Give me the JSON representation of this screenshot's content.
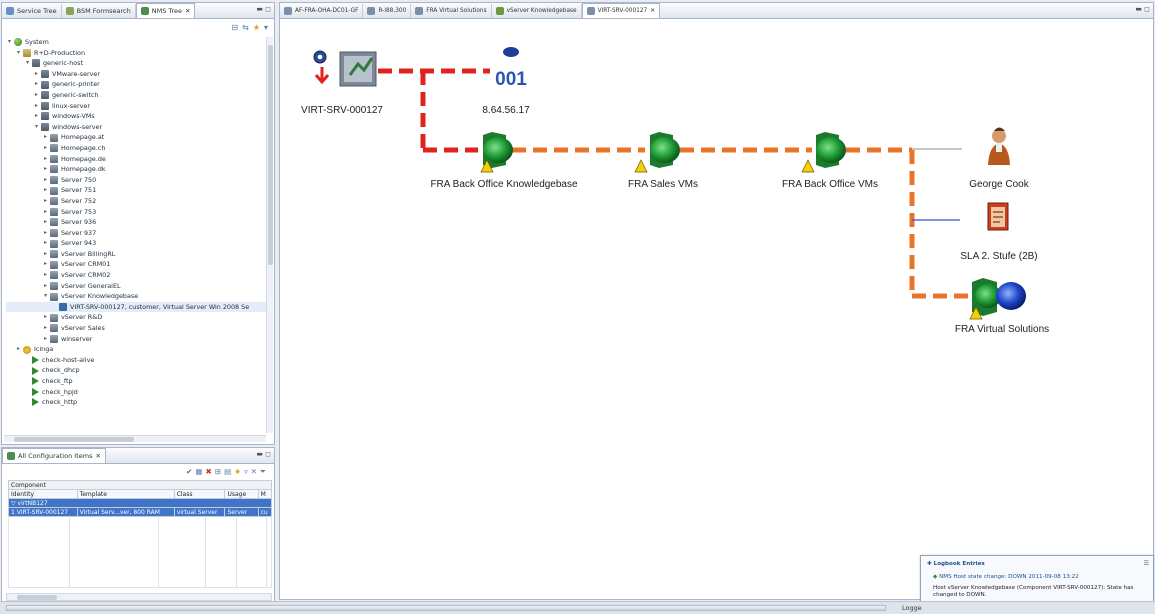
{
  "left_top": {
    "tabs": [
      {
        "label": "Service Tree"
      },
      {
        "label": "BSM Formsearch"
      },
      {
        "label": "NMS Tree"
      }
    ],
    "active_tab": 2,
    "tree": [
      {
        "depth": 0,
        "exp": "▾",
        "icon": "sys",
        "label": "System"
      },
      {
        "depth": 1,
        "exp": "▾",
        "icon": "folder",
        "label": "R+D-Production"
      },
      {
        "depth": 2,
        "exp": "▾",
        "icon": "host",
        "label": "generic-host"
      },
      {
        "depth": 3,
        "exp": "▸",
        "icon": "host",
        "label": "VMware-server"
      },
      {
        "depth": 3,
        "exp": "▸",
        "icon": "host",
        "label": "generic-printer"
      },
      {
        "depth": 3,
        "exp": "▸",
        "icon": "host",
        "label": "generic-switch"
      },
      {
        "depth": 3,
        "exp": "▸",
        "icon": "host",
        "label": "linux-server"
      },
      {
        "depth": 3,
        "exp": "▸",
        "icon": "host",
        "label": "windows-VMs"
      },
      {
        "depth": 3,
        "exp": "▾",
        "icon": "host",
        "label": "windows-server"
      },
      {
        "depth": 4,
        "exp": "▸",
        "icon": "srv",
        "label": "Homepage.at"
      },
      {
        "depth": 4,
        "exp": "▸",
        "icon": "srv",
        "label": "Homepage.ch"
      },
      {
        "depth": 4,
        "exp": "▸",
        "icon": "srv",
        "label": "Homepage.de"
      },
      {
        "depth": 4,
        "exp": "▸",
        "icon": "srv",
        "label": "Homepage.dk"
      },
      {
        "depth": 4,
        "exp": "▸",
        "icon": "srv",
        "label": "Server 750"
      },
      {
        "depth": 4,
        "exp": "▸",
        "icon": "srv",
        "label": "Server 751"
      },
      {
        "depth": 4,
        "exp": "▸",
        "icon": "srv",
        "label": "Server 752"
      },
      {
        "depth": 4,
        "exp": "▸",
        "icon": "srv",
        "label": "Server 753"
      },
      {
        "depth": 4,
        "exp": "▸",
        "icon": "srv",
        "label": "Server 936"
      },
      {
        "depth": 4,
        "exp": "▸",
        "icon": "srv",
        "label": "Server 937"
      },
      {
        "depth": 4,
        "exp": "▸",
        "icon": "srv",
        "label": "Server 943"
      },
      {
        "depth": 4,
        "exp": "▸",
        "icon": "srv",
        "label": "vServer BillingRL"
      },
      {
        "depth": 4,
        "exp": "▸",
        "icon": "srv",
        "label": "vServer CRM01"
      },
      {
        "depth": 4,
        "exp": "▸",
        "icon": "srv",
        "label": "vServer CRM02"
      },
      {
        "depth": 4,
        "exp": "▸",
        "icon": "srv",
        "label": "vServer GeneralEL"
      },
      {
        "depth": 4,
        "exp": "▾",
        "icon": "srv",
        "label": "vServer Knowledgebase"
      },
      {
        "depth": 5,
        "exp": "",
        "icon": "item",
        "label": "VIRT-SRV-000127, customer, Virtual Server Win 2008 Se",
        "sel": true
      },
      {
        "depth": 4,
        "exp": "▸",
        "icon": "srv",
        "label": "vServer R&D"
      },
      {
        "depth": 4,
        "exp": "▸",
        "icon": "srv",
        "label": "vServer Sales"
      },
      {
        "depth": 4,
        "exp": "▸",
        "icon": "srv",
        "label": "winserver"
      },
      {
        "depth": 1,
        "exp": "▸",
        "icon": "bulb",
        "label": "Icinga"
      },
      {
        "depth": 2,
        "exp": "",
        "icon": "play",
        "label": "check-host-alive"
      },
      {
        "depth": 2,
        "exp": "",
        "icon": "play",
        "label": "check_dhcp"
      },
      {
        "depth": 2,
        "exp": "",
        "icon": "play",
        "label": "check_ftp"
      },
      {
        "depth": 2,
        "exp": "",
        "icon": "play",
        "label": "check_hpjd"
      },
      {
        "depth": 2,
        "exp": "",
        "icon": "play",
        "label": "check_http"
      }
    ]
  },
  "left_bottom": {
    "title": "All Configuration Items",
    "group_header": "Component",
    "columns": [
      "Identity",
      "Template",
      "Class",
      "Usage",
      "M"
    ],
    "rows": [
      {
        "marker": "▽",
        "cells": [
          "virtNB127",
          "",
          "",
          "",
          ""
        ]
      },
      {
        "marker": "1",
        "cells": [
          "VIRT-SRV-000127",
          "Virtual Serv...ver, 800 RAM",
          "virtual Server",
          "Server",
          "cu"
        ]
      }
    ]
  },
  "editor": {
    "tabs": [
      {
        "label": "AF-FRA-OHA-DC01-GF"
      },
      {
        "label": "R-l88,300"
      },
      {
        "label": "FRA Virtual Solutions"
      },
      {
        "label": "vServer Knowledgebase"
      },
      {
        "label": "VIRT-SRV-000127"
      }
    ],
    "active_tab": 4
  },
  "nodes": {
    "virt_srv": {
      "label": "VIRT-SRV-000127"
    },
    "ip_node": {
      "number": "001",
      "label": "8.64.56.17"
    },
    "back_office_kb": {
      "label": "FRA Back Office Knowledgebase"
    },
    "sales_vms": {
      "label": "FRA Sales VMs"
    },
    "back_office_vms": {
      "label": "FRA Back Office VMs"
    },
    "george": {
      "label": "George Cook"
    },
    "sla": {
      "label": "SLA 2. Stufe (2B)"
    },
    "virtual_solutions": {
      "label": "FRA Virtual Solutions"
    }
  },
  "logbook": {
    "title": "Logbook Entries",
    "entry_title": "NMS Host state change: DOWN 2011-09-08 13:22",
    "entry_body": "Host vServer Knowledgebase (Component VIRT-SRV-000127): State has changed to DOWN."
  },
  "statusbar": {
    "right_label": "Logge"
  },
  "colors": {
    "down": "#e0231c",
    "warning": "#e8742a",
    "link_gray": "#a7a7a7",
    "link_blue": "#3a4fd0",
    "selection": "#3f74c9"
  }
}
